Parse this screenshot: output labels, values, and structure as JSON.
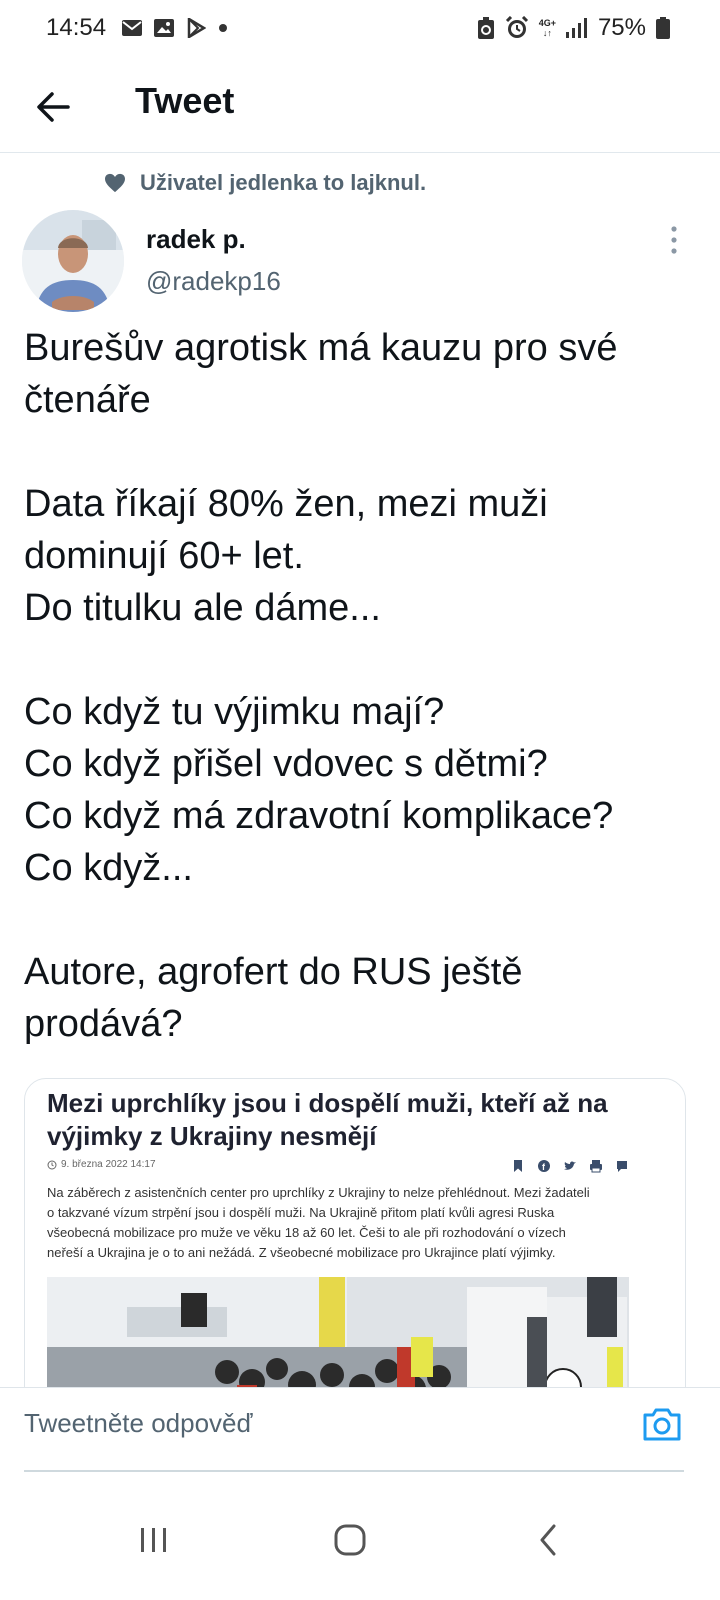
{
  "status_bar": {
    "time": "14:54",
    "network": "4G+",
    "battery": "75%"
  },
  "header": {
    "title": "Tweet"
  },
  "social_context": {
    "text": "Uživatel jedlenka to lajknul."
  },
  "tweet": {
    "author_name": "radek p.",
    "author_handle": "@radekp16",
    "body": {
      "p1_l1": "Burešův agrotisk má kauzu pro své",
      "p1_l2": "čtenáře",
      "p2_l1": "Data říkají 80% žen, mezi muži",
      "p2_l2": "dominují 60+ let.",
      "p2_l3": "Do titulku ale dáme...",
      "p3_l1": "Co když tu výjimku mají?",
      "p3_l2": "Co když přišel vdovec s dětmi?",
      "p3_l3": "Co když má zdravotní komplikace?",
      "p3_l4": "Co když...",
      "p4_l1": "Autore, agrofert do RUS ještě",
      "p4_l2": "prodává?"
    },
    "card": {
      "headline": "Mezi uprchlíky jsou i dospělí muži, kteří až na výjimky z Ukrajiny nesmějí",
      "date": "9. března 2022  14:17",
      "lead_l1": "Na záběrech z asistenčních center pro uprchlíky z Ukrajiny to nelze přehlédnout. Mezi žadateli",
      "lead_l2": "o takzvané vízum strpění jsou i dospělí muži. Na Ukrajině přitom platí kvůli agresi Ruska",
      "lead_l3": "všeobecná mobilizace pro muže ve věku 18 až 60 let. Češi to ale při rozhodování o vízech",
      "lead_l4": "neřeší a Ukrajina je o to ani nežádá. Z všeobecné mobilizace pro Ukrajince platí výjimky."
    }
  },
  "reply": {
    "placeholder": "Tweetněte odpověď"
  },
  "colors": {
    "accent": "#1d9bf0",
    "text": "#0f1419",
    "secondary": "#536471",
    "divider": "#e1e8ed"
  },
  "icons": [
    "email-icon",
    "image-icon",
    "play-store-icon",
    "recycle-icon",
    "alarm-icon",
    "signal-icon",
    "battery-icon",
    "back-arrow-icon",
    "heart-icon",
    "more-vertical-icon",
    "camera-icon",
    "recent-apps-icon",
    "home-icon",
    "system-back-icon"
  ]
}
